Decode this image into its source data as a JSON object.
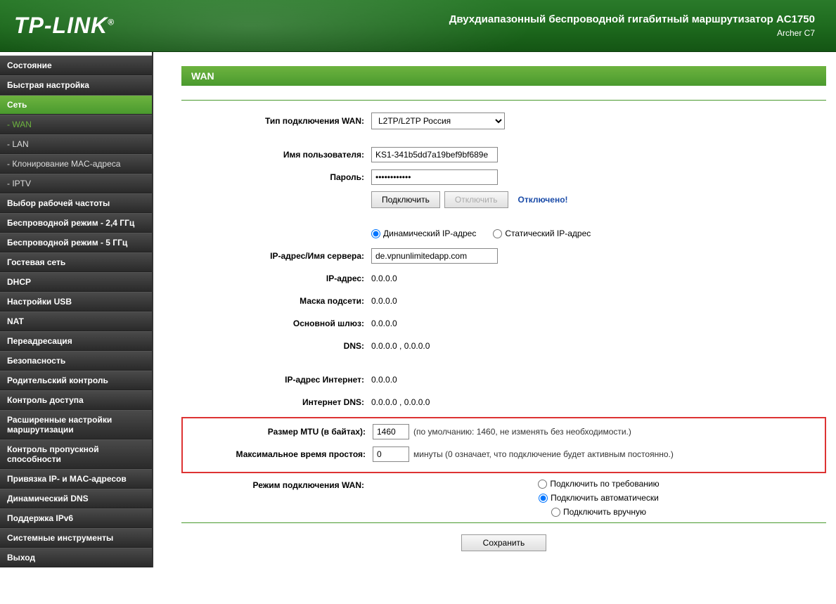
{
  "header": {
    "logo": "TP-LINK",
    "logo_mark": "®",
    "product_title": "Двухдиапазонный беспроводной гигабитный маршрутизатор AC1750",
    "product_model": "Archer C7"
  },
  "sidebar": {
    "items": [
      {
        "label": "Состояние",
        "type": "top"
      },
      {
        "label": "Быстрая настройка",
        "type": "top"
      },
      {
        "label": "Сеть",
        "type": "top",
        "active": true
      },
      {
        "label": "- WAN",
        "type": "sub",
        "current": true
      },
      {
        "label": "- LAN",
        "type": "sub"
      },
      {
        "label": "- Клонирование MAC-адреса",
        "type": "sub"
      },
      {
        "label": "- IPTV",
        "type": "sub"
      },
      {
        "label": "Выбор рабочей частоты",
        "type": "top"
      },
      {
        "label": "Беспроводной режим - 2,4 ГГц",
        "type": "top"
      },
      {
        "label": "Беспроводной режим - 5 ГГц",
        "type": "top"
      },
      {
        "label": "Гостевая сеть",
        "type": "top"
      },
      {
        "label": "DHCP",
        "type": "top"
      },
      {
        "label": "Настройки USB",
        "type": "top"
      },
      {
        "label": "NAT",
        "type": "top"
      },
      {
        "label": "Переадресация",
        "type": "top"
      },
      {
        "label": "Безопасность",
        "type": "top"
      },
      {
        "label": "Родительский контроль",
        "type": "top"
      },
      {
        "label": "Контроль доступа",
        "type": "top"
      },
      {
        "label": "Расширенные настройки маршрутизации",
        "type": "top"
      },
      {
        "label": "Контроль пропускной способности",
        "type": "top"
      },
      {
        "label": "Привязка IP- и MAC-адресов",
        "type": "top"
      },
      {
        "label": "Динамический DNS",
        "type": "top"
      },
      {
        "label": "Поддержка IPv6",
        "type": "top"
      },
      {
        "label": "Системные инструменты",
        "type": "top"
      },
      {
        "label": "Выход",
        "type": "top"
      }
    ]
  },
  "page": {
    "title": "WAN",
    "labels": {
      "wan_type": "Тип подключения WAN:",
      "username": "Имя пользователя:",
      "password": "Пароль:",
      "server": "IP-адрес/Имя сервера:",
      "ip": "IP-адрес:",
      "mask": "Маска подсети:",
      "gateway": "Основной шлюз:",
      "dns": "DNS:",
      "internet_ip": "IP-адрес Интернет:",
      "internet_dns": "Интернет DNS:",
      "mtu": "Размер MTU (в байтах):",
      "idle": "Максимальное время простоя:",
      "connect_mode": "Режим подключения WAN:"
    },
    "values": {
      "wan_type_selected": "L2TP/L2TP Россия",
      "username": "KS1-341b5dd7a19bef9bf689e",
      "password": "••••••••••••",
      "server": "de.vpnunlimitedapp.com",
      "ip": "0.0.0.0",
      "mask": "0.0.0.0",
      "gateway": "0.0.0.0",
      "dns": "0.0.0.0 , 0.0.0.0",
      "internet_ip": "0.0.0.0",
      "internet_dns": "0.0.0.0 , 0.0.0.0",
      "mtu": "1460",
      "idle": "0"
    },
    "buttons": {
      "connect": "Подключить",
      "disconnect": "Отключить",
      "save": "Сохранить"
    },
    "status": "Отключено!",
    "radios": {
      "dynamic": "Динамический IP-адрес",
      "static": "Статический IP-адрес",
      "on_demand": "Подключить по требованию",
      "auto": "Подключить автоматически",
      "manual": "Подключить вручную"
    },
    "hints": {
      "mtu": "(по умолчанию: 1460, не изменять без необходимости.)",
      "idle": "минуты (0 означает, что подключение будет активным постоянно.)"
    }
  }
}
